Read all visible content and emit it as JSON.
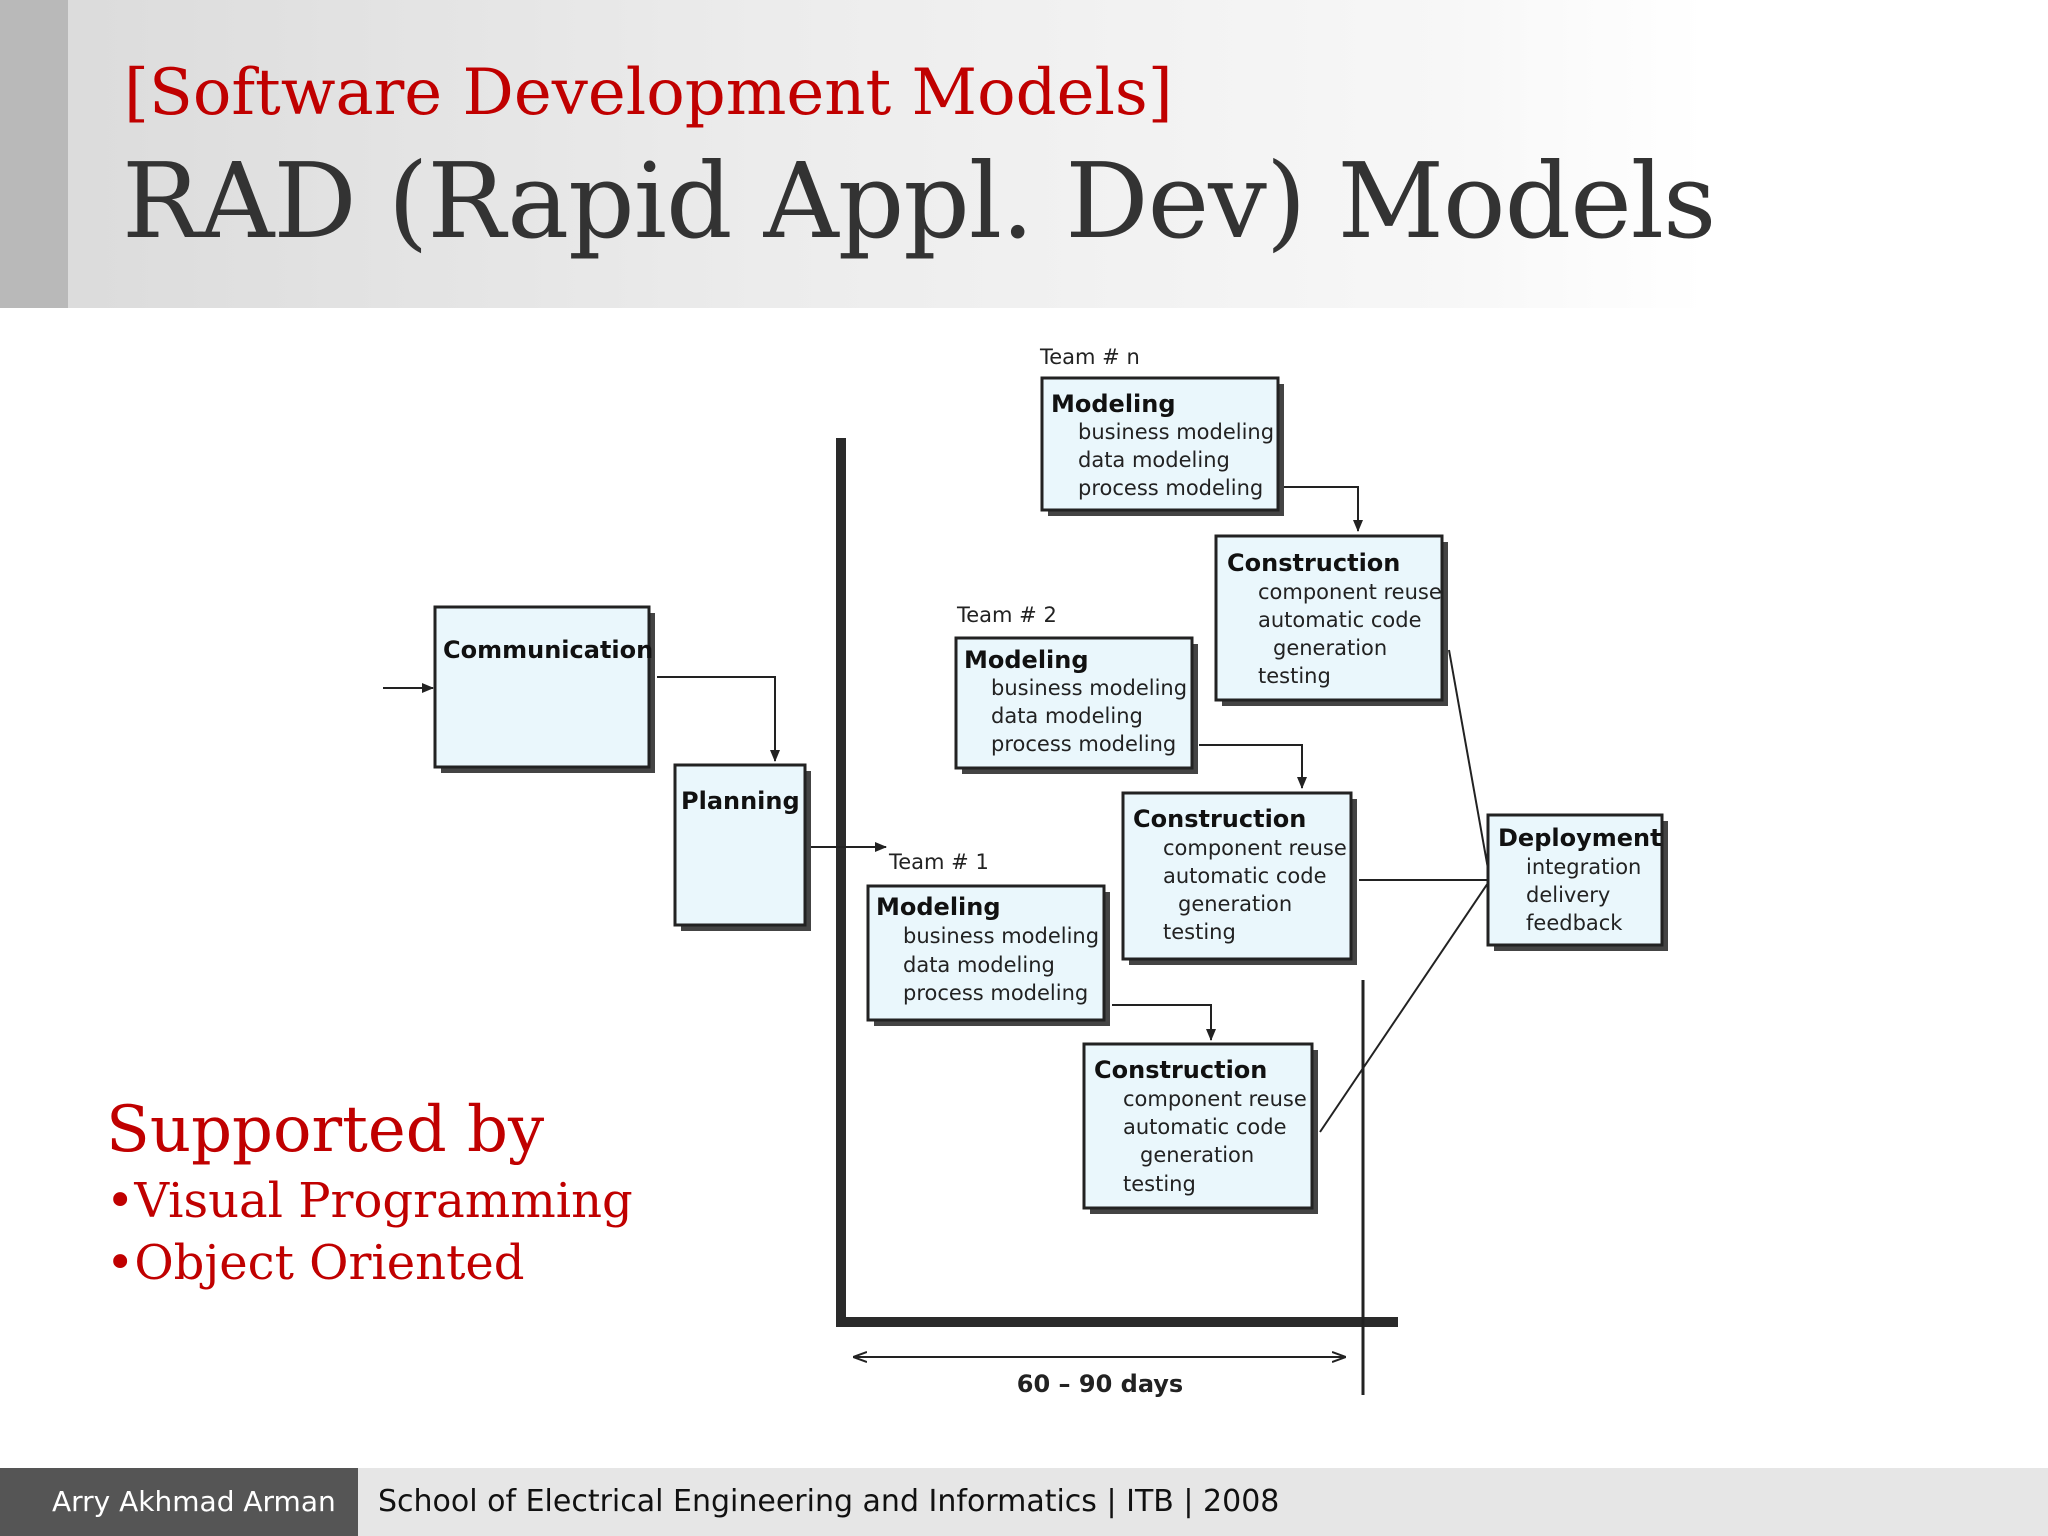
{
  "slide": {
    "subtitle": "[Software Development Models]",
    "title": "RAD (Rapid Appl. Dev) Models"
  },
  "support": {
    "heading": "Supported by",
    "items": [
      "•Visual Programming",
      "•Object Oriented"
    ]
  },
  "diagram": {
    "communication": "Communication",
    "planning": "Planning",
    "team_labels": [
      "Team # n",
      "Team # 2",
      "Team # 1"
    ],
    "modeling": {
      "title": "Modeling",
      "lines": [
        "business modeling",
        "data modeling",
        "process modeling"
      ]
    },
    "construction": {
      "title": "Construction",
      "lines": [
        "component reuse",
        "automatic code",
        "generation",
        "testing"
      ]
    },
    "deployment": {
      "title": "Deployment",
      "lines": [
        "integration",
        "delivery",
        "feedback"
      ]
    },
    "timebox": "60 – 90 days"
  },
  "footer": {
    "author": "Arry Akhmad Arman",
    "school": "School of Electrical Engineering and Informatics | ITB | 2008"
  },
  "colors": {
    "accent_red": "#c00000",
    "box_fill": "#eaf7fc",
    "box_border": "#222222"
  }
}
